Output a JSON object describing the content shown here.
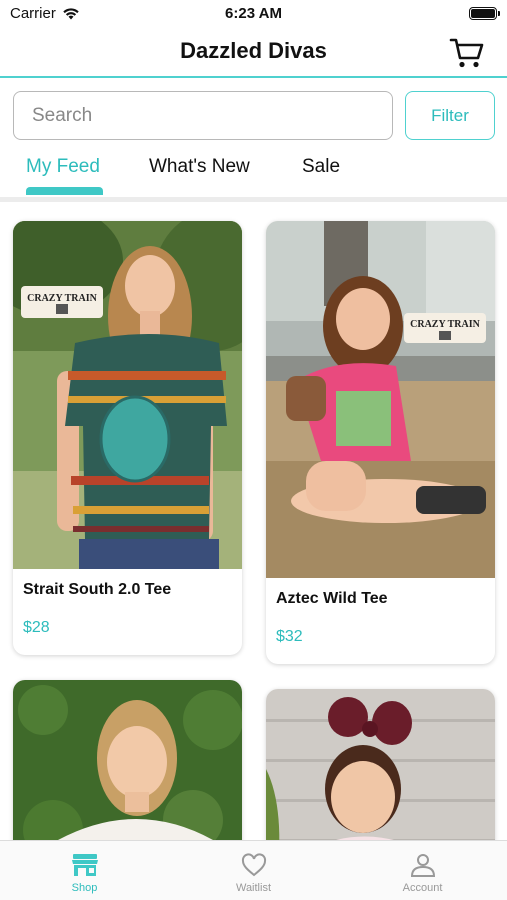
{
  "status_bar": {
    "carrier": "Carrier",
    "time": "6:23 AM"
  },
  "header": {
    "title": "Dazzled Divas"
  },
  "search": {
    "placeholder": "Search",
    "filter_label": "Filter"
  },
  "tabs": [
    {
      "label": "My Feed",
      "active": true
    },
    {
      "label": "What's New",
      "active": false
    },
    {
      "label": "Sale",
      "active": false
    }
  ],
  "products": [
    {
      "name": "Strait South 2.0 Tee",
      "price": "$28",
      "logo_text": "CRAZY TRAIN"
    },
    {
      "name": "Aztec Wild Tee",
      "price": "$32",
      "logo_text": "CRAZY TRAIN"
    },
    {
      "name": "",
      "price": ""
    },
    {
      "name": "",
      "price": ""
    }
  ],
  "tab_bar": [
    {
      "label": "Shop",
      "icon": "storefront-icon",
      "active": true
    },
    {
      "label": "Waitlist",
      "icon": "heart-icon",
      "active": false
    },
    {
      "label": "Account",
      "icon": "person-icon",
      "active": false
    }
  ],
  "colors": {
    "accent": "#3fc8c6",
    "accent_text": "#2dbcbc",
    "divider": "#ececec"
  }
}
